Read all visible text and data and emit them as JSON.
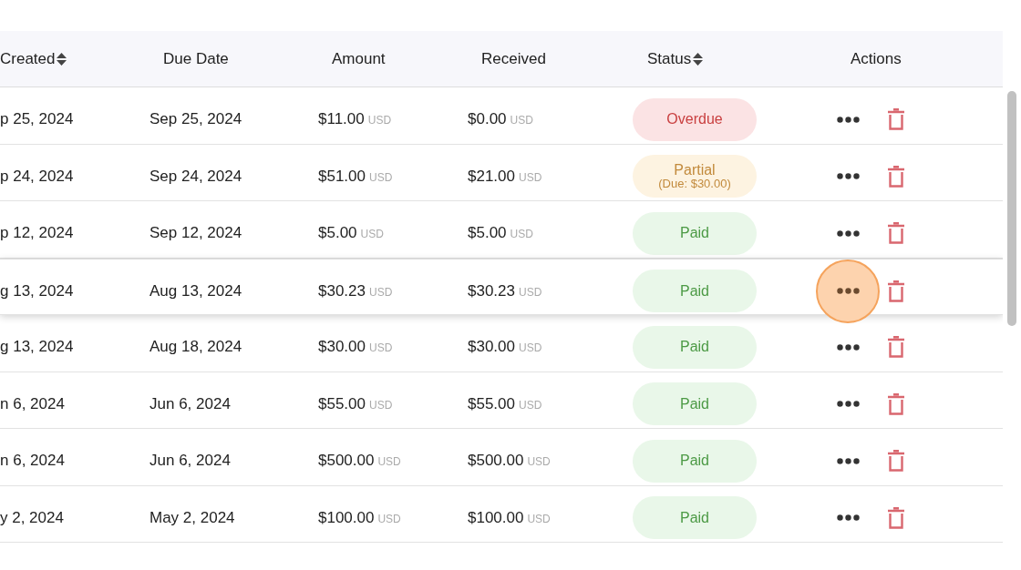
{
  "table": {
    "columns": [
      {
        "label": "Created",
        "sortable": true
      },
      {
        "label": "Due Date",
        "sortable": false
      },
      {
        "label": "Amount",
        "sortable": false
      },
      {
        "label": "Received",
        "sortable": false
      },
      {
        "label": "Status",
        "sortable": true
      },
      {
        "label": "Actions",
        "sortable": false
      }
    ],
    "rows": [
      {
        "created": "p 25, 2024",
        "due": "Sep 25, 2024",
        "amount": "$11.00",
        "amount_currency": "USD",
        "received": "$0.00",
        "received_currency": "USD",
        "status": {
          "kind": "overdue",
          "label": "Overdue"
        },
        "hovered": false,
        "menu_highlighted": false
      },
      {
        "created": "p 24, 2024",
        "due": "Sep 24, 2024",
        "amount": "$51.00",
        "amount_currency": "USD",
        "received": "$21.00",
        "received_currency": "USD",
        "status": {
          "kind": "partial",
          "label": "Partial",
          "note": "(Due: $30.00)"
        },
        "hovered": false,
        "menu_highlighted": false
      },
      {
        "created": "p 12, 2024",
        "due": "Sep 12, 2024",
        "amount": "$5.00",
        "amount_currency": "USD",
        "received": "$5.00",
        "received_currency": "USD",
        "status": {
          "kind": "paid",
          "label": "Paid"
        },
        "hovered": false,
        "menu_highlighted": false
      },
      {
        "created": "g 13, 2024",
        "due": "Aug 13, 2024",
        "amount": "$30.23",
        "amount_currency": "USD",
        "received": "$30.23",
        "received_currency": "USD",
        "status": {
          "kind": "paid",
          "label": "Paid"
        },
        "hovered": true,
        "menu_highlighted": true
      },
      {
        "created": "g 13, 2024",
        "due": "Aug 18, 2024",
        "amount": "$30.00",
        "amount_currency": "USD",
        "received": "$30.00",
        "received_currency": "USD",
        "status": {
          "kind": "paid",
          "label": "Paid"
        },
        "hovered": false,
        "menu_highlighted": false
      },
      {
        "created": "n 6, 2024",
        "due": "Jun 6, 2024",
        "amount": "$55.00",
        "amount_currency": "USD",
        "received": "$55.00",
        "received_currency": "USD",
        "status": {
          "kind": "paid",
          "label": "Paid"
        },
        "hovered": false,
        "menu_highlighted": false
      },
      {
        "created": "n 6, 2024",
        "due": "Jun 6, 2024",
        "amount": "$500.00",
        "amount_currency": "USD",
        "received": "$500.00",
        "received_currency": "USD",
        "status": {
          "kind": "paid",
          "label": "Paid"
        },
        "hovered": false,
        "menu_highlighted": false
      },
      {
        "created": "y 2, 2024",
        "due": "May 2, 2024",
        "amount": "$100.00",
        "amount_currency": "USD",
        "received": "$100.00",
        "received_currency": "USD",
        "status": {
          "kind": "paid",
          "label": "Paid"
        },
        "hovered": false,
        "menu_highlighted": false
      }
    ]
  }
}
